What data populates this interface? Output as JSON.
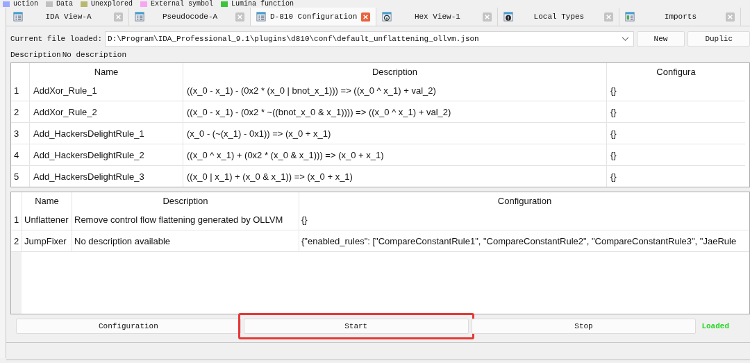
{
  "legend": [
    {
      "label": "uction",
      "color": "#9aa8ff"
    },
    {
      "label": "Data",
      "color": "#c0c0c0"
    },
    {
      "label": "Unexplored",
      "color": "#b8b870"
    },
    {
      "label": "External symbol",
      "color": "#f7a6f2"
    },
    {
      "label": "Lumina function",
      "color": "#3cc43c"
    }
  ],
  "tabs": [
    {
      "label": "IDA View-A",
      "kind": "listing",
      "selected": false
    },
    {
      "label": "Pseudocode-A",
      "kind": "listing",
      "selected": false
    },
    {
      "label": "D-810 Configuration",
      "kind": "listing",
      "selected": true
    },
    {
      "label": "Hex View-1",
      "kind": "hex",
      "selected": false
    },
    {
      "label": "Local Types",
      "kind": "info",
      "selected": false
    },
    {
      "label": "Imports",
      "kind": "imports",
      "selected": false
    }
  ],
  "file_row": {
    "label": "Current file loaded:",
    "value": "D:\\Program\\IDA_Professional_9.1\\plugins\\d810\\conf\\default_unflattening_ollvm.json",
    "buttons": [
      "New",
      "Duplic"
    ]
  },
  "description": {
    "label": "Description",
    "value": "No description"
  },
  "rules_table": {
    "columns": [
      "Name",
      "Description",
      "Configura"
    ],
    "rows": [
      {
        "index": "1",
        "cells": [
          "AddXor_Rule_1",
          "((x_0 - x_1) - (0x2 * (x_0 | bnot_x_1))) => ((x_0 ^ x_1) + val_2)",
          "{}"
        ]
      },
      {
        "index": "2",
        "cells": [
          "AddXor_Rule_2",
          "((x_0 - x_1) - (0x2 * ~((bnot_x_0 & x_1)))) => ((x_0 ^ x_1) + val_2)",
          "{}"
        ]
      },
      {
        "index": "3",
        "cells": [
          "Add_HackersDelightRule_1",
          "(x_0 - (~(x_1) - 0x1)) => (x_0 + x_1)",
          "{}"
        ]
      },
      {
        "index": "4",
        "cells": [
          "Add_HackersDelightRule_2",
          "((x_0 ^ x_1) + (0x2 * (x_0 & x_1))) => (x_0 + x_1)",
          "{}"
        ]
      },
      {
        "index": "5",
        "cells": [
          "Add_HackersDelightRule_3",
          "((x_0 | x_1) + (x_0 & x_1)) => (x_0 + x_1)",
          "{}"
        ]
      }
    ]
  },
  "blocks_table": {
    "columns": [
      "Name",
      "Description",
      "Configuration"
    ],
    "rows": [
      {
        "index": "1",
        "cells": [
          "Unflattener",
          "Remove control flow flattening generated by OLLVM",
          "{}"
        ]
      },
      {
        "index": "2",
        "cells": [
          "JumpFixer",
          "No description available",
          "{\"enabled_rules\": [\"CompareConstantRule1\", \"CompareConstantRule2\", \"CompareConstantRule3\", \"JaeRule"
        ]
      }
    ]
  },
  "actions": [
    {
      "label": "Configuration",
      "highlighted": false
    },
    {
      "label": "Start",
      "highlighted": true
    },
    {
      "label": "Stop",
      "highlighted": false
    }
  ],
  "status": "Loaded"
}
